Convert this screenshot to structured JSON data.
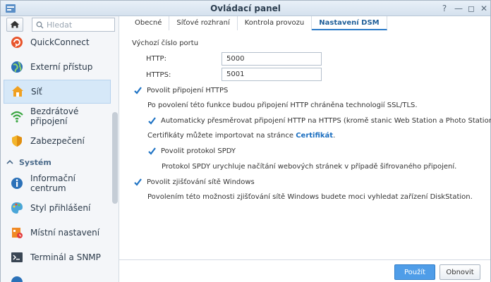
{
  "window": {
    "title": "Ovládací panel"
  },
  "search": {
    "placeholder": "Hledat"
  },
  "sidebar": {
    "items": [
      {
        "label": "QuickConnect",
        "icon": "quickconnect-icon"
      },
      {
        "label": "Externí přístup",
        "icon": "globe-icon"
      },
      {
        "label": "Síť",
        "icon": "home-network-icon",
        "active": true
      },
      {
        "label": "Bezdrátové připojení",
        "icon": "wifi-icon"
      },
      {
        "label": "Zabezpečení",
        "icon": "shield-icon"
      }
    ],
    "section": "Systém",
    "system_items": [
      {
        "label": "Informační centrum",
        "icon": "info-icon"
      },
      {
        "label": "Styl přihlášení",
        "icon": "palette-icon"
      },
      {
        "label": "Místní nastavení",
        "icon": "regional-icon"
      },
      {
        "label": "Terminál a SNMP",
        "icon": "terminal-icon"
      }
    ]
  },
  "tabs": [
    {
      "label": "Obecné"
    },
    {
      "label": "Síťové rozhraní"
    },
    {
      "label": "Kontrola provozu"
    },
    {
      "label": "Nastavení DSM",
      "active": true
    }
  ],
  "content": {
    "port_heading": "Výchozí číslo portu",
    "http_label": "HTTP:",
    "http_value": "5000",
    "https_label": "HTTPS:",
    "https_value": "5001",
    "enable_https": "Povolit připojení HTTPS",
    "https_desc": "Po povolení této funkce budou připojení HTTP chráněna technologií SSL/TLS.",
    "auto_redirect": "Automaticky přesměrovat připojení HTTP na HTTPS (kromě stanic Web Station a Photo Station)",
    "cert_text": "Certifikáty můžete importovat na stránce ",
    "cert_link": "Certifikát",
    "cert_end": ".",
    "enable_spdy": "Povolit protokol SPDY",
    "spdy_desc": "Protokol SPDY urychluje načítání webových stránek v případě šifrovaného připojení.",
    "enable_wsd": "Povolit zjišťování sítě Windows",
    "wsd_desc": "Povolením této možnosti zjišťování sítě Windows budete moci vyhledat zařízení DiskStation."
  },
  "footer": {
    "apply": "Použít",
    "revert": "Obnovit"
  },
  "colors": {
    "accent": "#2a7ac8",
    "apply_bg": "#4f9de8",
    "active_bg": "#d6e8f8"
  }
}
